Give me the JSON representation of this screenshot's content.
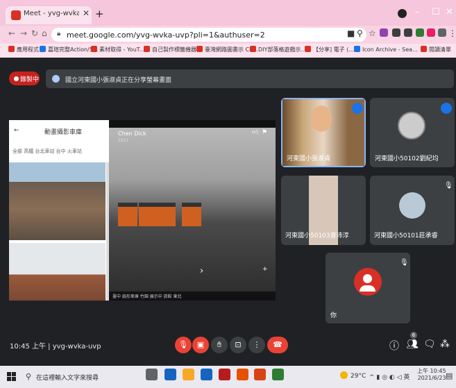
{
  "browser": {
    "tab_title": "Meet - yvg-wvka-uvp",
    "tab_close": "✕",
    "new_tab": "+",
    "url": "meet.google.com/yvg-wvka-uvp?pli=1&authuser=2",
    "bookmarks": [
      "應用程式",
      "嘉瑄完整Action/5...",
      "素材取得 - YouT...",
      "自己製作標籤機器...",
      "臺灣網路圖書示 Ch...",
      "DIY部落格遊戲示...",
      "【分享] 電子 (...",
      "Icon Archive - Sea...",
      "閱讀清單"
    ]
  },
  "meet": {
    "recording_label": "錄製中",
    "banner_text": "國立河東國小張淑貞正在分享螢幕畫面",
    "presentation": {
      "side_header": "動畫攝影車庫",
      "side_tabs": "全部   高鐵   台北車站   台中   火車站",
      "author": "Chen Dick",
      "date": "2021",
      "footer": "臺中 扇形車庫   竹園   展示中   旅館   東北"
    },
    "tiles": [
      {
        "name": "河東國小張淑貞",
        "speaking": true
      },
      {
        "name": "河東國小50102劉紀均",
        "speaking": true
      },
      {
        "name": "河東國小50103曾沛淳",
        "muted": false
      },
      {
        "name": "河東國小50101莊承睿",
        "muted": true
      },
      {
        "name": "你",
        "muted": true
      }
    ],
    "self_initial": "",
    "meeting_info": "10:45 上午 | yvg-wvka-uvp",
    "participants_count": "6"
  },
  "taskbar": {
    "search_placeholder": "在這裡輸入文字來搜尋",
    "weather": "29°C",
    "time": "上午 10:45",
    "date": "2021/6/23"
  },
  "colors": {
    "meet_bg": "#202124",
    "tile_bg": "#3c4043",
    "recording_red": "#c5221f",
    "end_call_red": "#ea4335",
    "speaking_blue": "#1a73e8",
    "tabstrip_pink": "#f5c6dc"
  }
}
